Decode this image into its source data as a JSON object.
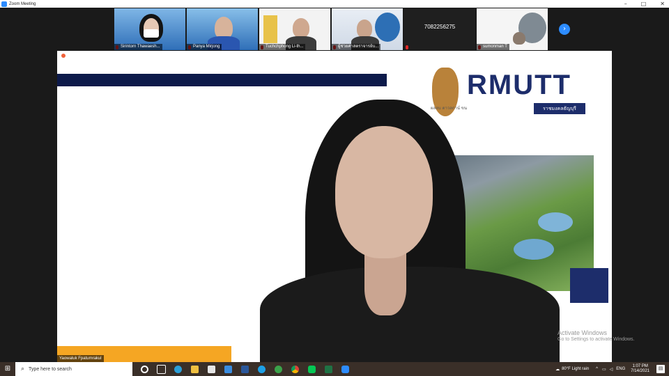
{
  "window": {
    "title": "Zoom Meeting",
    "controls": [
      "–",
      "□",
      "✕"
    ]
  },
  "participants": [
    {
      "name": "Sirintorn Thawaesh...",
      "style": "blue-bg-mask"
    },
    {
      "name": "Panya Mirjong",
      "style": "blue-bg"
    },
    {
      "name": "Tuchchphong Li-th...",
      "style": "light-bg"
    },
    {
      "name": "ผู้ช่วยศาสตราจารย์บ...",
      "style": "blue-bg-older"
    },
    {
      "name": "",
      "number": "7082256275",
      "style": "dark"
    },
    {
      "name": "sumonman T",
      "style": "light-bg"
    }
  ],
  "share": {
    "logo": "RMUTT",
    "sub": "ผลลบ ตาวลกาน์ ขน",
    "badge": "ราชมงคลธัญบุรี"
  },
  "active_speaker": {
    "name": "Yaowaluk Fpatumrakul"
  },
  "watermark": {
    "line1": "Activate Windows",
    "line2": "Go to Settings to activate Windows."
  },
  "taskbar": {
    "search_placeholder": "Type here to search",
    "weather": "80°F  Light rain",
    "time": "1:07 PM",
    "date": "7/14/2021",
    "lang": "ENG"
  },
  "colors": {
    "zoom_blue": "#2d8cff",
    "navy": "#1d2d6b",
    "orange": "#f5a623",
    "taskbar": "#3a2f28"
  }
}
